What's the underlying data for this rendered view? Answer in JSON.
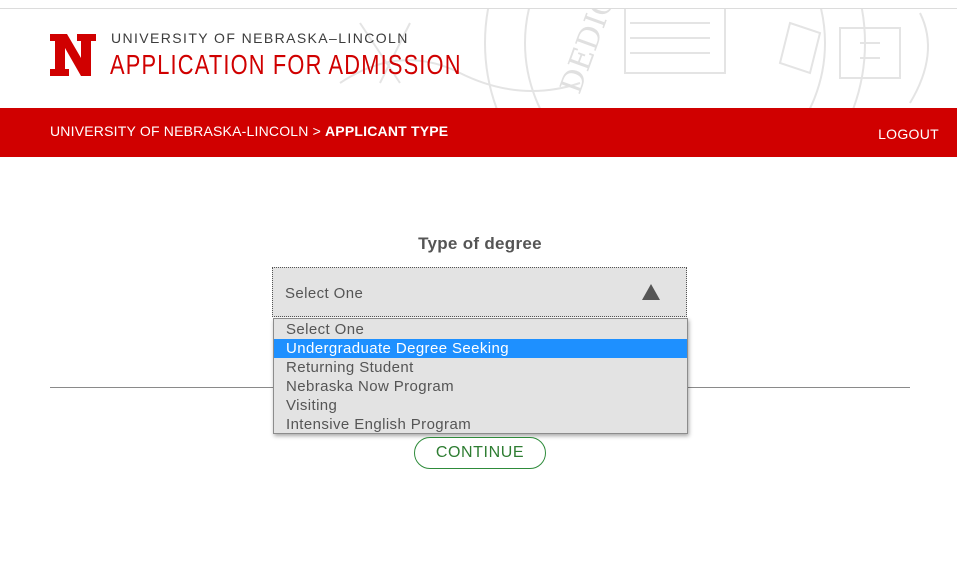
{
  "header": {
    "logo": "N",
    "university": "UNIVERSITY OF NEBRASKA–LINCOLN",
    "title": "APPLICATION FOR ADMISSION",
    "seal_text": "DEDICATED ARS"
  },
  "nav": {
    "breadcrumb_root": "UNIVERSITY OF NEBRASKA-LINCOLN",
    "separator": ">",
    "breadcrumb_current": "APPLICANT TYPE",
    "logout_label": "LOGOUT"
  },
  "form": {
    "label": "Type of degree",
    "select": {
      "value": "Select One",
      "options": [
        "Select One",
        "Undergraduate Degree Seeking",
        "Returning Student",
        "Nebraska Now Program",
        "Visiting",
        "Intensive English Program"
      ],
      "highlighted_index": 1
    },
    "continue_label": "CONTINUE"
  },
  "colors": {
    "brand_red": "#d00000",
    "highlight": "#1e90ff",
    "continue_green": "#2e7d32"
  }
}
